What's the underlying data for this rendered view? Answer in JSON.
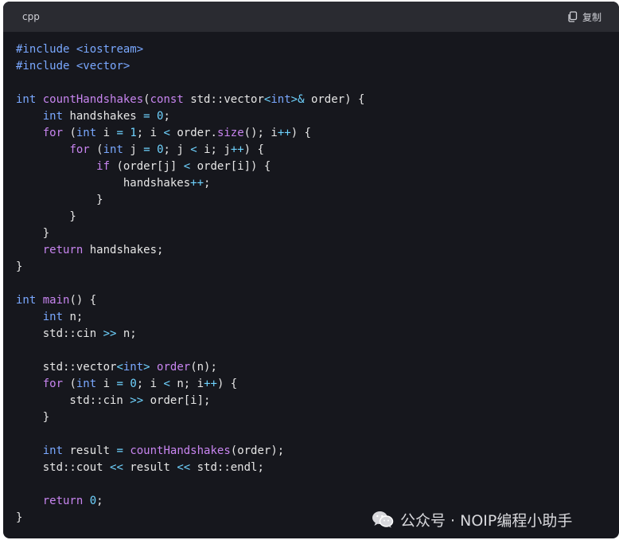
{
  "header": {
    "language": "cpp",
    "copy_label": "复制",
    "copy_icon": "clipboard-icon"
  },
  "code_lines": [
    [
      {
        "t": "#include",
        "c": "pre"
      },
      {
        "t": " "
      },
      {
        "t": "<iostream>",
        "c": "pre"
      }
    ],
    [
      {
        "t": "#include",
        "c": "pre"
      },
      {
        "t": " "
      },
      {
        "t": "<vector>",
        "c": "pre"
      }
    ],
    [],
    [
      {
        "t": "int",
        "c": "type"
      },
      {
        "t": " "
      },
      {
        "t": "countHandshakes",
        "c": "fn"
      },
      {
        "t": "("
      },
      {
        "t": "const",
        "c": "kw"
      },
      {
        "t": " std::vector"
      },
      {
        "t": "<",
        "c": "op"
      },
      {
        "t": "int",
        "c": "type"
      },
      {
        "t": ">&",
        "c": "op"
      },
      {
        "t": " order) {"
      }
    ],
    [
      {
        "t": "    "
      },
      {
        "t": "int",
        "c": "type"
      },
      {
        "t": " handshakes "
      },
      {
        "t": "=",
        "c": "op"
      },
      {
        "t": " "
      },
      {
        "t": "0",
        "c": "num"
      },
      {
        "t": ";"
      }
    ],
    [
      {
        "t": "    "
      },
      {
        "t": "for",
        "c": "kw"
      },
      {
        "t": " ("
      },
      {
        "t": "int",
        "c": "type"
      },
      {
        "t": " i "
      },
      {
        "t": "=",
        "c": "op"
      },
      {
        "t": " "
      },
      {
        "t": "1",
        "c": "num"
      },
      {
        "t": "; i "
      },
      {
        "t": "<",
        "c": "op"
      },
      {
        "t": " order."
      },
      {
        "t": "size",
        "c": "fn"
      },
      {
        "t": "(); i"
      },
      {
        "t": "++",
        "c": "op"
      },
      {
        "t": ") {"
      }
    ],
    [
      {
        "t": "        "
      },
      {
        "t": "for",
        "c": "kw"
      },
      {
        "t": " ("
      },
      {
        "t": "int",
        "c": "type"
      },
      {
        "t": " j "
      },
      {
        "t": "=",
        "c": "op"
      },
      {
        "t": " "
      },
      {
        "t": "0",
        "c": "num"
      },
      {
        "t": "; j "
      },
      {
        "t": "<",
        "c": "op"
      },
      {
        "t": " i; j"
      },
      {
        "t": "++",
        "c": "op"
      },
      {
        "t": ") {"
      }
    ],
    [
      {
        "t": "            "
      },
      {
        "t": "if",
        "c": "kw"
      },
      {
        "t": " (order[j] "
      },
      {
        "t": "<",
        "c": "op"
      },
      {
        "t": " order[i]) {"
      }
    ],
    [
      {
        "t": "                handshakes"
      },
      {
        "t": "++",
        "c": "op"
      },
      {
        "t": ";"
      }
    ],
    [
      {
        "t": "            }"
      }
    ],
    [
      {
        "t": "        }"
      }
    ],
    [
      {
        "t": "    }"
      }
    ],
    [
      {
        "t": "    "
      },
      {
        "t": "return",
        "c": "kw"
      },
      {
        "t": " handshakes;"
      }
    ],
    [
      {
        "t": "}"
      }
    ],
    [],
    [
      {
        "t": "int",
        "c": "type"
      },
      {
        "t": " "
      },
      {
        "t": "main",
        "c": "fn"
      },
      {
        "t": "() {"
      }
    ],
    [
      {
        "t": "    "
      },
      {
        "t": "int",
        "c": "type"
      },
      {
        "t": " n;"
      }
    ],
    [
      {
        "t": "    std::cin "
      },
      {
        "t": ">>",
        "c": "op"
      },
      {
        "t": " n;"
      }
    ],
    [],
    [
      {
        "t": "    std::vector"
      },
      {
        "t": "<",
        "c": "op"
      },
      {
        "t": "int",
        "c": "type"
      },
      {
        "t": ">",
        "c": "op"
      },
      {
        "t": " "
      },
      {
        "t": "order",
        "c": "fn"
      },
      {
        "t": "(n);"
      }
    ],
    [
      {
        "t": "    "
      },
      {
        "t": "for",
        "c": "kw"
      },
      {
        "t": " ("
      },
      {
        "t": "int",
        "c": "type"
      },
      {
        "t": " i "
      },
      {
        "t": "=",
        "c": "op"
      },
      {
        "t": " "
      },
      {
        "t": "0",
        "c": "num"
      },
      {
        "t": "; i "
      },
      {
        "t": "<",
        "c": "op"
      },
      {
        "t": " n; i"
      },
      {
        "t": "++",
        "c": "op"
      },
      {
        "t": ") {"
      }
    ],
    [
      {
        "t": "        std::cin "
      },
      {
        "t": ">>",
        "c": "op"
      },
      {
        "t": " order[i];"
      }
    ],
    [
      {
        "t": "    }"
      }
    ],
    [],
    [
      {
        "t": "    "
      },
      {
        "t": "int",
        "c": "type"
      },
      {
        "t": " result "
      },
      {
        "t": "=",
        "c": "op"
      },
      {
        "t": " "
      },
      {
        "t": "countHandshakes",
        "c": "fn"
      },
      {
        "t": "(order);"
      }
    ],
    [
      {
        "t": "    std::cout "
      },
      {
        "t": "<<",
        "c": "op"
      },
      {
        "t": " result "
      },
      {
        "t": "<<",
        "c": "op"
      },
      {
        "t": " std::endl;"
      }
    ],
    [],
    [
      {
        "t": "    "
      },
      {
        "t": "return",
        "c": "kw"
      },
      {
        "t": " "
      },
      {
        "t": "0",
        "c": "num"
      },
      {
        "t": ";"
      }
    ],
    [
      {
        "t": "}"
      }
    ]
  ],
  "watermark": {
    "icon": "wechat-icon",
    "text": "公众号 · NOIP编程小助手"
  },
  "colors": {
    "background": "#16171d",
    "header": "#2a2b31",
    "keyword": "#c885f0",
    "type": "#7aa8ff",
    "number": "#6fd3ff",
    "text": "#e6e6e6"
  }
}
